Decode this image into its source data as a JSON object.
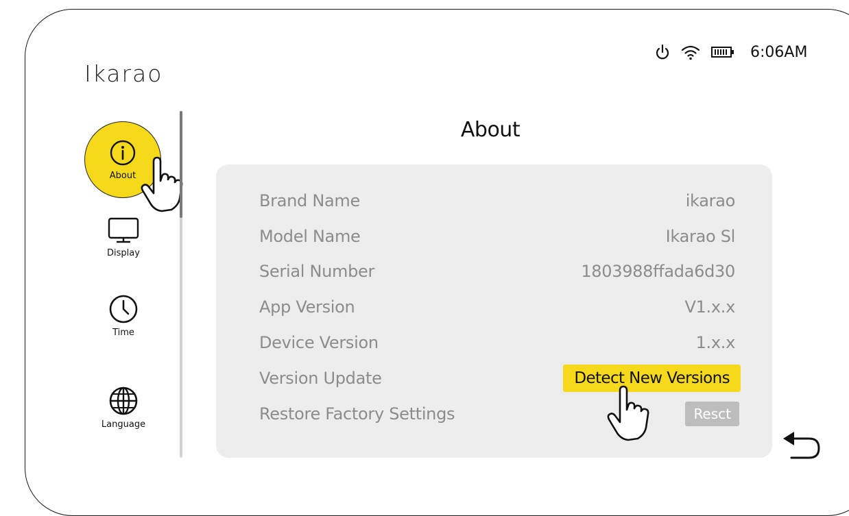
{
  "app": {
    "title": "Ikarao"
  },
  "status": {
    "time": "6:06AM",
    "icons": [
      "power-icon",
      "wifi-icon",
      "battery-icon"
    ]
  },
  "sidebar": {
    "items": [
      {
        "label": "About",
        "icon": "info-icon",
        "active": true
      },
      {
        "label": "Display",
        "icon": "monitor-icon"
      },
      {
        "label": "Time",
        "icon": "clock-icon"
      },
      {
        "label": "Language",
        "icon": "globe-icon"
      }
    ]
  },
  "main": {
    "title": "About",
    "rows": [
      {
        "key": "Brand Name",
        "value": "ikarao"
      },
      {
        "key": "Model Name",
        "value": "Ikarao Sl"
      },
      {
        "key": "Serial Number",
        "value": "1803988ffada6d30"
      },
      {
        "key": "App Version",
        "value": "V1.x.x"
      },
      {
        "key": "Device Version",
        "value": "1.x.x"
      },
      {
        "key": "Version Update",
        "button": "Detect New Versions"
      },
      {
        "key": "Restore Factory Settings",
        "button": "Resct"
      }
    ]
  },
  "colors": {
    "accent": "#f6d91a",
    "panel": "#ededed",
    "muted_text": "#8c8c8c",
    "disabled_button": "#bdbdbd"
  }
}
